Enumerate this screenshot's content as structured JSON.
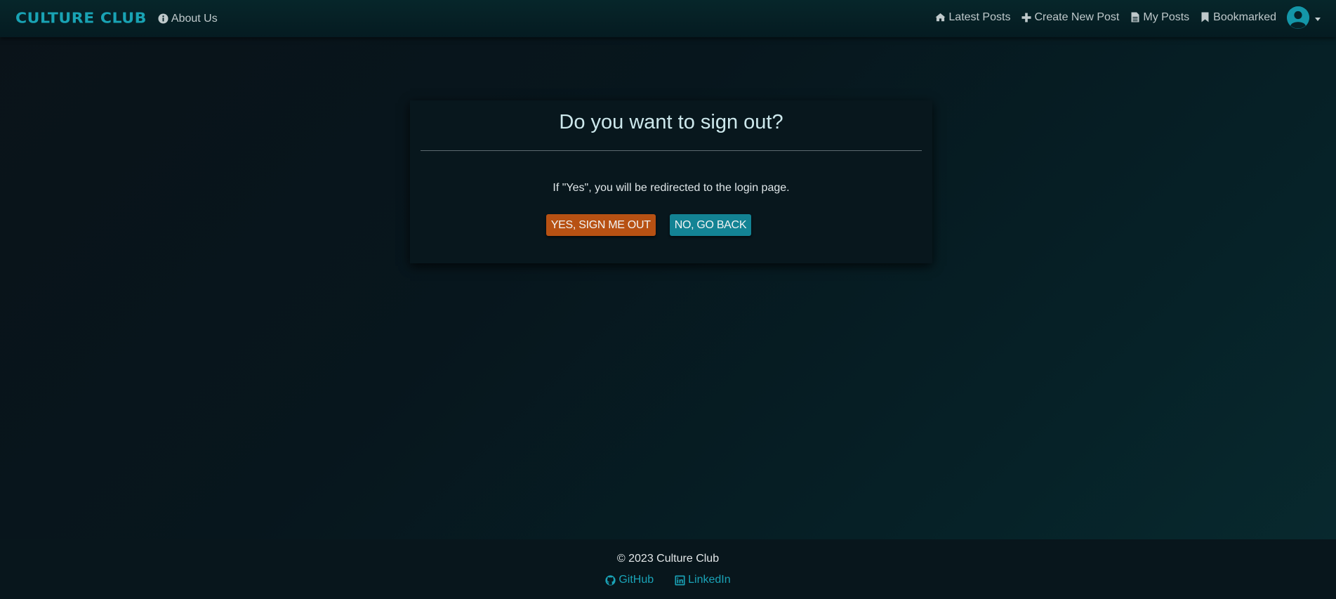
{
  "navbar": {
    "brand": "CULTURE CLUB",
    "about_label": "About Us",
    "links": {
      "latest_posts": "Latest Posts",
      "create_post": "Create New Post",
      "my_posts": "My Posts",
      "bookmarked": "Bookmarked"
    },
    "icons": {
      "about": "info-circle-icon",
      "latest_posts": "home-icon",
      "create_post": "plus-icon",
      "my_posts": "file-icon",
      "bookmarked": "bookmark-icon",
      "avatar": "user-circle-icon"
    }
  },
  "modal": {
    "title": "Do you want to sign out?",
    "message": "If \"Yes\", you will be redirected to the login page.",
    "confirm_label": "Yes, sign me out",
    "cancel_label": "No, go back"
  },
  "footer": {
    "copyright": "© 2023 Culture Club",
    "github_label": "GitHub",
    "linkedin_label": "LinkedIn"
  },
  "colors": {
    "brand": "#19a3b4",
    "confirm_button": "#b75113",
    "cancel_button": "#138394",
    "background": "#07161d"
  }
}
